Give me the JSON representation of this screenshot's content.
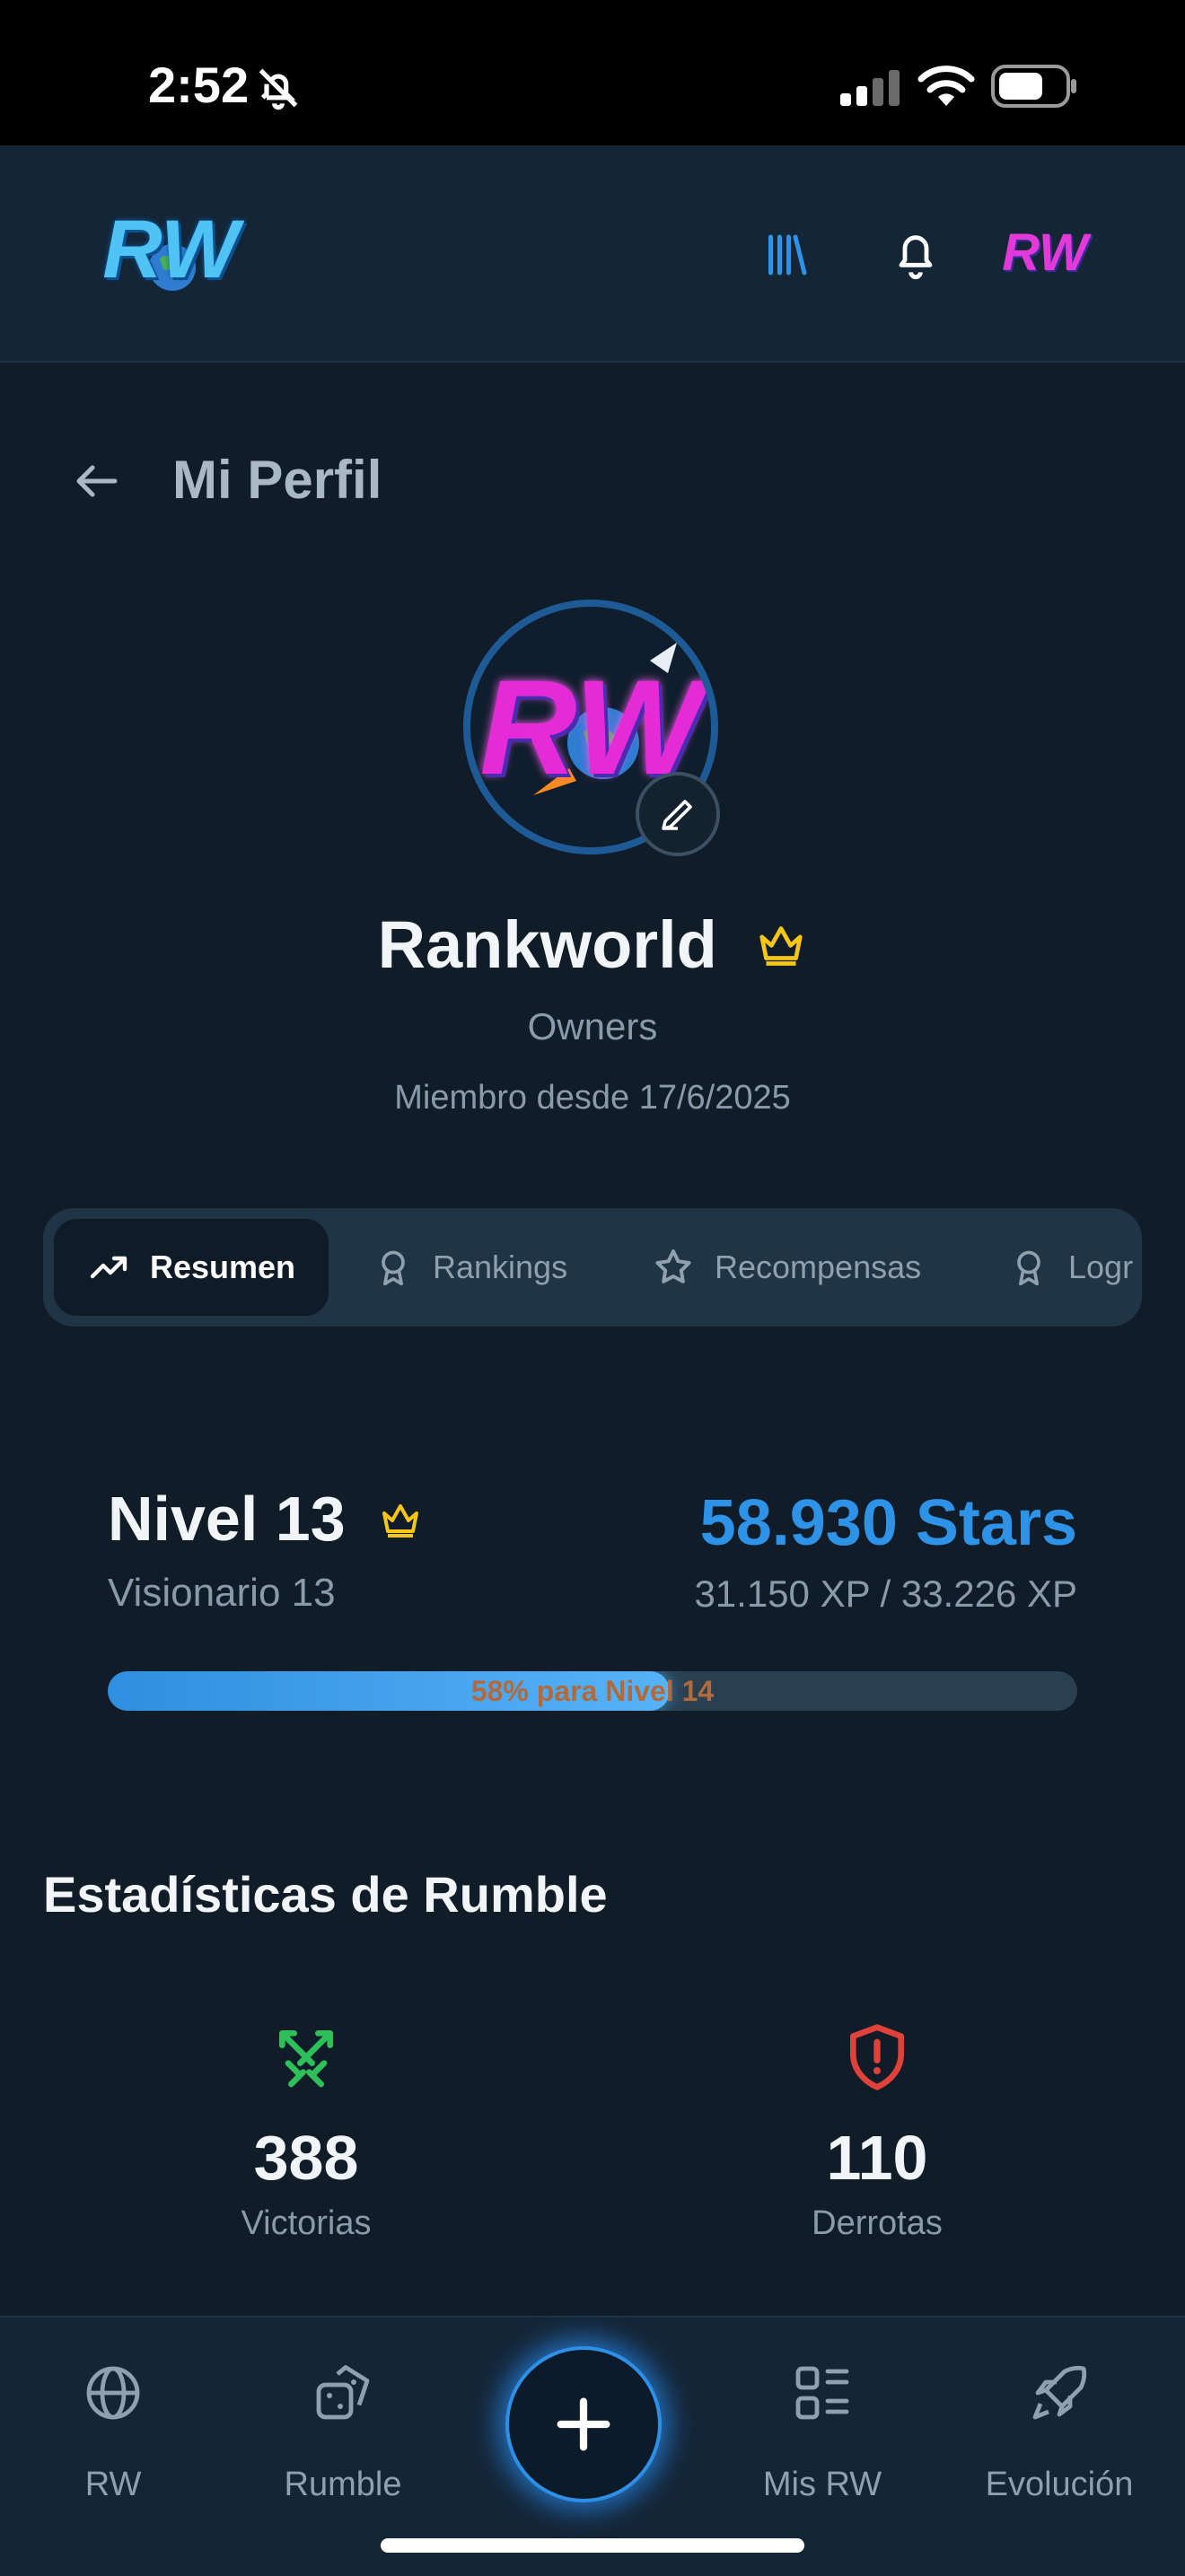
{
  "status_bar": {
    "time": "2:52"
  },
  "header": {
    "logo_text": "RW",
    "avatar_text": "RW"
  },
  "page": {
    "title": "Mi Perfil"
  },
  "profile": {
    "username": "Rankworld",
    "role": "Owners",
    "member_since": "Miembro desde 17/6/2025",
    "avatar_text": "RW"
  },
  "tabs": [
    {
      "label": "Resumen",
      "icon": "trending-up-icon",
      "active": true
    },
    {
      "label": "Rankings",
      "icon": "award-icon",
      "active": false
    },
    {
      "label": "Recompensas",
      "icon": "star-icon",
      "active": false
    },
    {
      "label": "Logr",
      "icon": "award-icon",
      "active": false
    }
  ],
  "level": {
    "title": "Nivel 13",
    "subtitle": "Visionario 13",
    "stars": "58.930 Stars",
    "xp": "31.150 XP / 33.226 XP",
    "progress_label": "58% para Nivel 14",
    "progress_fraction": 0.58
  },
  "stats": {
    "title": "Estadísticas de Rumble",
    "wins": {
      "value": "388",
      "label": "Victorias"
    },
    "losses": {
      "value": "110",
      "label": "Derrotas"
    }
  },
  "bottom_nav": [
    {
      "label": "RW",
      "icon": "globe-icon"
    },
    {
      "label": "Rumble",
      "icon": "dice-icon"
    },
    {
      "label": "",
      "icon": "plus-icon"
    },
    {
      "label": "Mis RW",
      "icon": "dashboard-icon"
    },
    {
      "label": "Evolución",
      "icon": "rocket-icon"
    }
  ],
  "colors": {
    "accent": "#2e93e6",
    "crown": "#f5c518",
    "wins": "#2fbf5a",
    "losses": "#e0413a",
    "background": "#101c28"
  }
}
